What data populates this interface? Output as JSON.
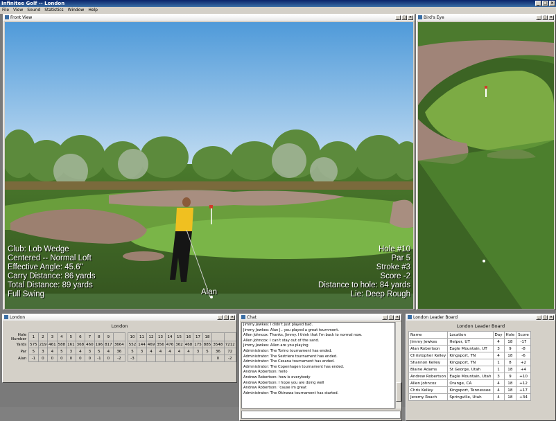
{
  "app": {
    "title": "Infinitee Golf -- London"
  },
  "menu": [
    "File",
    "View",
    "Sound",
    "Statistics",
    "Window",
    "Help"
  ],
  "front_view": {
    "title": "Front View",
    "hud_left": [
      "Club: Lob Wedge",
      "Centered -- Normal Loft",
      "Effective Angle: 45.6\"",
      "Carry Distance: 86 yards",
      "Total Distance: 89 yards",
      "Full Swing"
    ],
    "hud_right": [
      "Hole #10",
      "Par 5",
      "Stroke #3",
      "Score -2",
      "Distance to hole: 84 yards",
      "Lie: Deep Rough"
    ],
    "player": "Alan"
  },
  "birds_eye": {
    "title": "Bird's Eye"
  },
  "scorecard": {
    "window_title": "London",
    "title": "London",
    "rows": {
      "hole_label": "Hole Number",
      "holes_front": [
        "1",
        "2",
        "3",
        "4",
        "5",
        "6",
        "7",
        "8",
        "9"
      ],
      "holes_back": [
        "10",
        "11",
        "12",
        "13",
        "14",
        "15",
        "16",
        "17",
        "18"
      ],
      "yards_label": "Yards",
      "yards_front": [
        "575",
        "219",
        "461",
        "588",
        "161",
        "368",
        "460",
        "196",
        "817"
      ],
      "yards_front_total": "3664",
      "yards_back": [
        "552",
        "144",
        "469",
        "356",
        "476",
        "362",
        "468",
        "175",
        "885"
      ],
      "yards_back_total": "3548",
      "yards_total": "7212",
      "par_label": "Par",
      "par_front": [
        "5",
        "3",
        "4",
        "5",
        "3",
        "4",
        "3",
        "5",
        "4"
      ],
      "par_front_total": "36",
      "par_back": [
        "5",
        "3",
        "4",
        "4",
        "4",
        "4",
        "4",
        "3",
        "5"
      ],
      "par_back_total": "36",
      "par_total": "72",
      "player_label": "Alan",
      "player_front": [
        "-1",
        "0",
        "0",
        "0",
        "0",
        "0",
        "0",
        "-1",
        "0"
      ],
      "player_front_total": "-2",
      "player_back": [
        "-3"
      ],
      "player_back_total": "0",
      "player_total": "-2"
    }
  },
  "chat": {
    "title": "Chat",
    "lines": [
      "Jimmy Jewkes: I didn't just played bad.",
      "Jimmy Jewkes: Alan J.. you played a great tournment.",
      "Allen Johncox: Thanks, Jimmy. I think that I'm back to normal now.",
      "Allen Johncox: I can't stay out of the sand.",
      "Jimmy Jewkes: Allen are you playing",
      "Administrator: The Torino tournament has ended.",
      "Administrator: The Sestriere tournament has ended.",
      "Administrator: The Cesana tournament has ended.",
      "Administrator: The Copenhagen tournament has ended.",
      "Andrew Robertson: hello",
      "Andrew Robertson: how is everybody",
      "Andrew Robertson: I hope you are doing well",
      "Andrew Robertson: 'cause im great",
      "Administrator: The Okinawa tournament has started."
    ]
  },
  "leaderboard": {
    "window_title": "London Leader Board",
    "title": "London Leader Board",
    "columns": [
      "Name",
      "Location",
      "Day",
      "Hole",
      "Score"
    ],
    "rows": [
      [
        "Jimmy Jewkes",
        "Helper, UT",
        "4",
        "18",
        "-17"
      ],
      [
        "Alan Robertson",
        "Eagle Mountain, UT",
        "3",
        "9",
        "-8"
      ],
      [
        "Christopher Kelley",
        "Kingsport, TN",
        "4",
        "18",
        "-6"
      ],
      [
        "Shannon Kelley",
        "Kingsport, TN",
        "1",
        "8",
        "+2"
      ],
      [
        "Blaine Adams",
        "St George, Utah",
        "1",
        "18",
        "+4"
      ],
      [
        "Andrew Robertson",
        "Eagle Mountain, Utah",
        "3",
        "9",
        "+10"
      ],
      [
        "Allen Johncox",
        "Orange, CA",
        "4",
        "18",
        "+12"
      ],
      [
        "Chris Kelley",
        "Kingsport, Tennessee",
        "4",
        "18",
        "+17"
      ],
      [
        "Jeremy Roach",
        "Springville, Utah",
        "4",
        "18",
        "+34"
      ]
    ]
  }
}
